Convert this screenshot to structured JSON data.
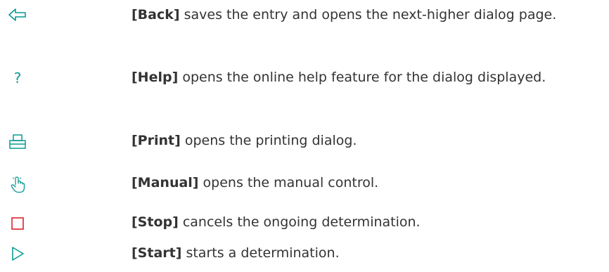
{
  "colors": {
    "teal": "#0a9a93",
    "red": "#e0202a",
    "text": "#333333"
  },
  "entries": [
    {
      "icon": "back-arrow-icon",
      "term": "[Back]",
      "text": " saves the entry and opens the next-higher dialog page."
    },
    {
      "icon": "help-question-icon",
      "term": "[Help]",
      "text": " opens the online help feature for the dialog dis­played."
    },
    {
      "icon": "printer-icon",
      "term": "[Print]",
      "text": " opens the printing dialog."
    },
    {
      "icon": "hand-pointer-icon",
      "term": "[Manual]",
      "text": " opens the manual control."
    },
    {
      "icon": "stop-square-icon",
      "term": "[Stop]",
      "text": " cancels the ongoing determination."
    },
    {
      "icon": "start-play-icon",
      "term": "[Start]",
      "text": " starts a determination."
    }
  ]
}
